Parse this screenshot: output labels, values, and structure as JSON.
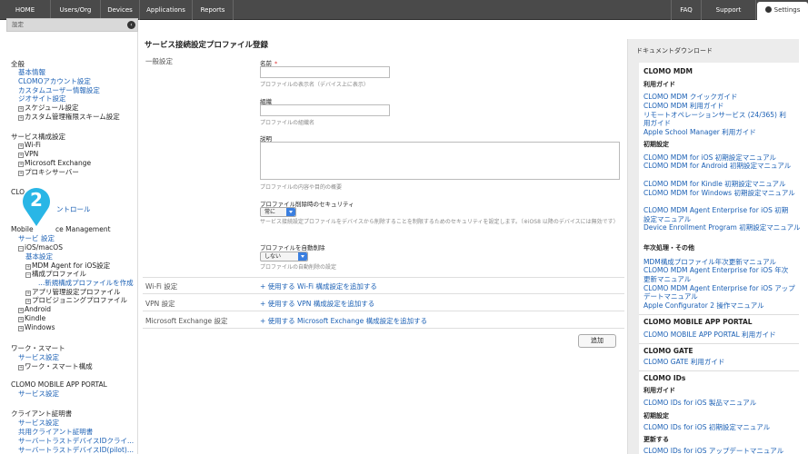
{
  "topnav": {
    "items": [
      "HOME",
      "Users/Org",
      "Devices",
      "Applications",
      "Reports"
    ],
    "right_items": [
      "FAQ",
      "Support"
    ],
    "settings_label": "Settings"
  },
  "sidebar": {
    "header": "設定",
    "collapse_icon": "chevron-left-icon",
    "lines": [
      {
        "text": "全般",
        "type": "h"
      },
      {
        "text": "基本情報",
        "type": "l"
      },
      {
        "text": "CLOMOアカウント設定",
        "type": "l"
      },
      {
        "text": "カスタムユーザー情報設定",
        "type": "l"
      },
      {
        "text": "ジオサイト設定",
        "type": "l"
      },
      {
        "text": "スケジュール設定",
        "type": "t",
        "exp": "+"
      },
      {
        "text": "カスタム管理権限スキーム設定",
        "type": "t",
        "exp": "+"
      },
      {
        "text": "サービス構成設定",
        "type": "h"
      },
      {
        "text": "Wi-Fi",
        "type": "t",
        "exp": "+"
      },
      {
        "text": "VPN",
        "type": "t",
        "exp": "+"
      },
      {
        "text": "Microsoft Exchange",
        "type": "t",
        "exp": "+"
      },
      {
        "text": "プロキシサーバー",
        "type": "t",
        "exp": "+"
      },
      {
        "text": "CLO",
        "type": "h"
      },
      {
        "text": "ントロール",
        "type": "l"
      },
      {
        "text": "Mobile",
        "type": "h"
      },
      {
        "text": "ce Management",
        "type": "h"
      },
      {
        "text": "サービ",
        "type": "l"
      },
      {
        "text": "設定",
        "type": "l"
      },
      {
        "text": "iOS/macOS",
        "type": "t",
        "exp": "-"
      },
      {
        "text": "基本設定",
        "type": "l"
      },
      {
        "text": "MDM Agent for iOS設定",
        "type": "t",
        "exp": "+"
      },
      {
        "text": "構成プロファイル",
        "type": "t",
        "exp": "-"
      },
      {
        "text": "...新規構成プロファイルを作成",
        "type": "l"
      },
      {
        "text": "アプリ管理設定プロファイル",
        "type": "t",
        "exp": "+"
      },
      {
        "text": "プロビジョニングプロファイル",
        "type": "t",
        "exp": "+"
      },
      {
        "text": "Android",
        "type": "t",
        "exp": "+"
      },
      {
        "text": "Kindle",
        "type": "t",
        "exp": "+"
      },
      {
        "text": "Windows",
        "type": "t",
        "exp": "+"
      },
      {
        "text": "ワーク・スマート",
        "type": "h"
      },
      {
        "text": "サービス設定",
        "type": "l"
      },
      {
        "text": "ワーク・スマート構成",
        "type": "t",
        "exp": "+"
      },
      {
        "text": "CLOMO MOBILE APP PORTAL",
        "type": "h"
      },
      {
        "text": "サービス設定",
        "type": "l"
      },
      {
        "text": "クライアント証明書",
        "type": "h"
      },
      {
        "text": "サービス設定",
        "type": "l"
      },
      {
        "text": "共用クライアント証明書",
        "type": "l"
      },
      {
        "text": "サーバートラストデバイスIDクライ...",
        "type": "l"
      },
      {
        "text": "サーバートラストデバイスID(pilot)...",
        "type": "l"
      }
    ]
  },
  "marker": {
    "number": "2"
  },
  "main": {
    "title": "サービス接続設定プロファイル登録",
    "general_label": "一般設定",
    "name_label": "名前",
    "required_mark": "*",
    "name_hint": "プロファイルの表示名（デバイス上に表示）",
    "org_label": "組織",
    "org_hint": "プロファイルの組織名",
    "desc_label": "説明",
    "desc_hint": "プロファイルの内容や目的の概要",
    "security_label": "プロファイル削除時のセキュリティ",
    "security_value": "常に",
    "security_hint": "サービス接続設定プロファイルをデバイスから削除することを制限するためのセキュリティを設定します。（※iOS8 以降のデバイスには無効です）",
    "autodelete_label": "プロファイルを自動削除",
    "autodelete_value": "しない",
    "autodelete_hint": "プロファイルの自動削除の設定",
    "wifi_label": "Wi-Fi 設定",
    "wifi_link": "+ 使用する Wi-Fi 構成設定を追加する",
    "vpn_label": "VPN 設定",
    "vpn_link": "+ 使用する VPN 構成設定を追加する",
    "exchange_label": "Microsoft Exchange 設定",
    "exchange_link": "+ 使用する Microsoft Exchange 構成設定を追加する",
    "add_button": "追加"
  },
  "docs": {
    "header": "ドキュメントダウンロード",
    "lines": [
      {
        "text": "CLOMO MDM",
        "type": "h1"
      },
      {
        "text": "利用ガイド",
        "type": "h2"
      },
      {
        "text": "CLOMO MDM クイックガイド",
        "type": "l"
      },
      {
        "text": "CLOMO MDM 利用ガイド",
        "type": "l"
      },
      {
        "text": "リモートオペレーションサービス (24/365) 利",
        "type": "l"
      },
      {
        "text": "用ガイド",
        "type": "l"
      },
      {
        "text": "Apple School Manager 利用ガイド",
        "type": "l"
      },
      {
        "text": "初期設定",
        "type": "h2"
      },
      {
        "text": "CLOMO MDM for iOS 初期設定マニュアル",
        "type": "l"
      },
      {
        "text": "CLOMO MDM for Android 初期設定マニュアル",
        "type": "l"
      },
      {
        "text": "CLOMO MDM for Kindle 初期設定マニュアル",
        "type": "l"
      },
      {
        "text": "CLOMO MDM for Windows 初期設定マニュアル",
        "type": "l"
      },
      {
        "text": "CLOMO MDM Agent Enterprise for iOS 初期",
        "type": "l"
      },
      {
        "text": "設定マニュアル",
        "type": "l"
      },
      {
        "text": "Device Enrollment Program 初期設定マニュアル",
        "type": "l"
      },
      {
        "text": "年次処理・その他",
        "type": "h2"
      },
      {
        "text": "MDM構成プロファイル年次更新マニュアル",
        "type": "l"
      },
      {
        "text": "CLOMO MDM Agent Enterprise for iOS 年次",
        "type": "l"
      },
      {
        "text": "更新マニュアル",
        "type": "l"
      },
      {
        "text": "CLOMO MDM Agent Enterprise for iOS アップ",
        "type": "l"
      },
      {
        "text": "デートマニュアル",
        "type": "l"
      },
      {
        "text": "Apple Configurator 2 操作マニュアル",
        "type": "l"
      },
      {
        "text": "CLOMO MOBILE APP PORTAL",
        "type": "h1"
      },
      {
        "text": "CLOMO MOBILE APP PORTAL 利用ガイド",
        "type": "l"
      },
      {
        "text": "CLOMO GATE",
        "type": "h1"
      },
      {
        "text": "CLOMO GATE 利用ガイド",
        "type": "l"
      },
      {
        "text": "CLOMO IDs",
        "type": "h1"
      },
      {
        "text": "利用ガイド",
        "type": "h2"
      },
      {
        "text": "CLOMO IDs for iOS 製品マニュアル",
        "type": "l"
      },
      {
        "text": "初期設定",
        "type": "h2"
      },
      {
        "text": "CLOMO IDs for iOS 初期設定マニュアル",
        "type": "l"
      },
      {
        "text": "更新する",
        "type": "h2"
      },
      {
        "text": "CLOMO IDs for iOS アップデートマニュアル",
        "type": "l"
      }
    ]
  },
  "colors": {
    "topbar": "#4a4a4a",
    "link": "#1a5fb4",
    "marker": "#29b6e6",
    "select_arrow": "#3b7fe0",
    "required": "#dd3333"
  }
}
